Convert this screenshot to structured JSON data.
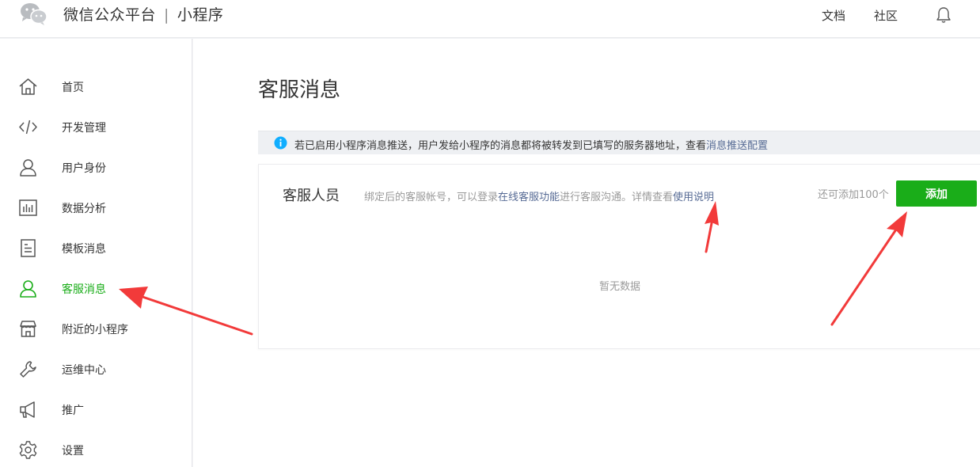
{
  "header": {
    "brand_name": "微信公众平台",
    "brand_separator": "|",
    "brand_product": "小程序",
    "links": {
      "docs": "文档",
      "community": "社区"
    }
  },
  "sidebar": {
    "items": [
      {
        "label": "首页",
        "icon": "home-icon"
      },
      {
        "label": "开发管理",
        "icon": "code-icon"
      },
      {
        "label": "用户身份",
        "icon": "user-icon"
      },
      {
        "label": "数据分析",
        "icon": "bar-chart-icon"
      },
      {
        "label": "模板消息",
        "icon": "document-icon"
      },
      {
        "label": "客服消息",
        "icon": "customer-service-icon",
        "active": true
      },
      {
        "label": "附近的小程序",
        "icon": "store-icon"
      },
      {
        "label": "运维中心",
        "icon": "wrench-icon"
      },
      {
        "label": "推广",
        "icon": "megaphone-icon"
      },
      {
        "label": "设置",
        "icon": "gear-icon"
      }
    ]
  },
  "main": {
    "title": "客服消息",
    "notice": {
      "text": "若已启用小程序消息推送，用户发给小程序的消息都将被转发到已填写的服务器地址，查看",
      "link": "消息推送配置"
    },
    "card": {
      "title": "客服人员",
      "desc_prefix": "绑定后的客服帐号，可以登录",
      "desc_link1": "在线客服功能",
      "desc_middle": "进行客服沟通。详情查看",
      "desc_link2": "使用说明",
      "remaining": "还可添加100个",
      "add_label": "添加",
      "empty_text": "暂无数据"
    }
  },
  "colors": {
    "accent_green": "#1aad19",
    "link_blue": "#576b95",
    "info_blue": "#10aeff",
    "arrow_red": "#f23a3a"
  }
}
